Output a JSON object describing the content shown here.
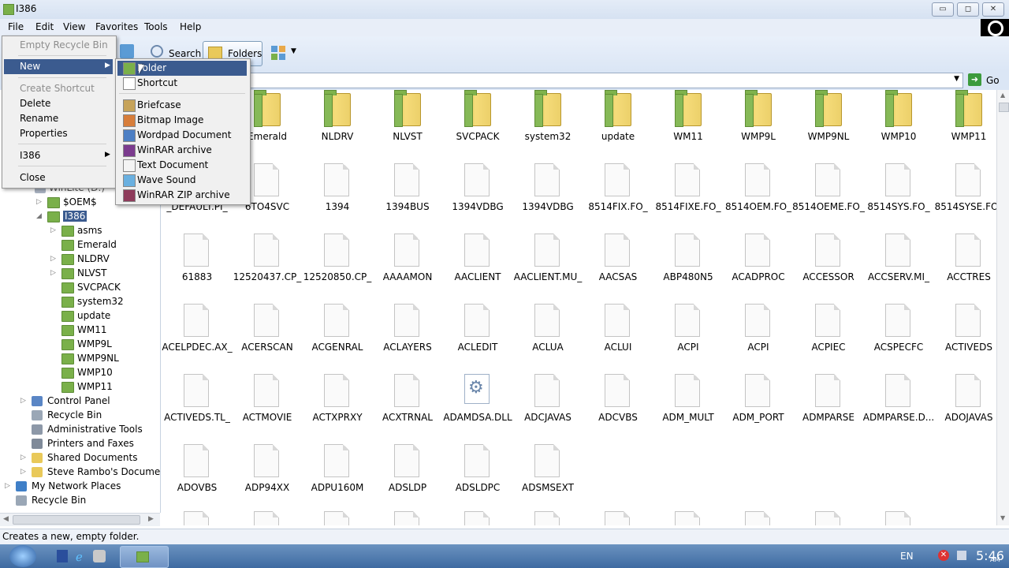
{
  "window": {
    "title": "I386",
    "minimize": "▭",
    "maximize": "◻",
    "close": "✕"
  },
  "menubar": [
    "File",
    "Edit",
    "View",
    "Favorites",
    "Tools",
    "Help"
  ],
  "toolbar": {
    "search_label": "Search",
    "folders_label": "Folders"
  },
  "address": {
    "go_label": "Go"
  },
  "file_menu": {
    "items": [
      {
        "label": "Empty Recycle Bin",
        "disabled": true
      },
      {
        "label": "New",
        "submenu": true,
        "highlighted": true
      },
      {
        "label": "Create Shortcut",
        "disabled": true
      },
      {
        "label": "Delete"
      },
      {
        "label": "Rename"
      },
      {
        "label": "Properties"
      },
      {
        "label": "I386",
        "submenu": true
      },
      {
        "label": "Close"
      }
    ]
  },
  "new_submenu": {
    "items": [
      {
        "label": "Folder",
        "icon": "folder-icon",
        "highlighted": true
      },
      {
        "label": "Shortcut",
        "icon": "shortcut-icon"
      },
      {
        "label": "Briefcase",
        "icon": "briefcase-icon"
      },
      {
        "label": "Bitmap Image",
        "icon": "bitmap-icon"
      },
      {
        "label": "Wordpad Document",
        "icon": "wordpad-icon"
      },
      {
        "label": "WinRAR archive",
        "icon": "winrar-icon"
      },
      {
        "label": "Text Document",
        "icon": "text-document-icon"
      },
      {
        "label": "Wave Sound",
        "icon": "wave-sound-icon"
      },
      {
        "label": "WinRAR ZIP archive",
        "icon": "winrar-zip-icon"
      }
    ]
  },
  "tree": {
    "partial_label": "WinLite (D:)",
    "items": [
      {
        "label": "$OEM$",
        "level": 2,
        "expander": "▷"
      },
      {
        "label": "I386",
        "level": 2,
        "expander": "◢",
        "selected": true
      },
      {
        "label": "asms",
        "level": 3,
        "expander": "▷"
      },
      {
        "label": "Emerald",
        "level": 3,
        "expander": ""
      },
      {
        "label": "NLDRV",
        "level": 3,
        "expander": "▷"
      },
      {
        "label": "NLVST",
        "level": 3,
        "expander": "▷"
      },
      {
        "label": "SVCPACK",
        "level": 3,
        "expander": ""
      },
      {
        "label": "system32",
        "level": 3,
        "expander": ""
      },
      {
        "label": "update",
        "level": 3,
        "expander": ""
      },
      {
        "label": "WM11",
        "level": 3,
        "expander": ""
      },
      {
        "label": "WMP9L",
        "level": 3,
        "expander": ""
      },
      {
        "label": "WMP9NL",
        "level": 3,
        "expander": ""
      },
      {
        "label": "WMP10",
        "level": 3,
        "expander": ""
      },
      {
        "label": "WMP11",
        "level": 3,
        "expander": ""
      },
      {
        "label": "Control Panel",
        "level": 1,
        "expander": "▷",
        "icon": "control-panel-icon"
      },
      {
        "label": "Recycle Bin",
        "level": 1,
        "expander": "",
        "icon": "recycle-bin-icon"
      },
      {
        "label": "Administrative Tools",
        "level": 1,
        "expander": "",
        "icon": "admin-tools-icon"
      },
      {
        "label": "Printers and Faxes",
        "level": 1,
        "expander": "",
        "icon": "printer-icon"
      },
      {
        "label": "Shared Documents",
        "level": 1,
        "expander": "▷",
        "icon": "shared-docs-icon"
      },
      {
        "label": "Steve Rambo's Documents",
        "level": 1,
        "expander": "▷",
        "icon": "user-docs-icon"
      },
      {
        "label": "My Network Places",
        "level": 0,
        "expander": "▷",
        "icon": "network-icon"
      },
      {
        "label": "Recycle Bin",
        "level": 0,
        "expander": "",
        "icon": "recycle-bin-icon"
      }
    ]
  },
  "files": [
    {
      "name": "Emerald",
      "type": "folder"
    },
    {
      "name": "NLDRV",
      "type": "folder"
    },
    {
      "name": "NLVST",
      "type": "folder"
    },
    {
      "name": "SVCPACK",
      "type": "folder"
    },
    {
      "name": "system32",
      "type": "folder"
    },
    {
      "name": "update",
      "type": "folder"
    },
    {
      "name": "WM11",
      "type": "folder"
    },
    {
      "name": "WMP9L",
      "type": "folder"
    },
    {
      "name": "WMP9NL",
      "type": "folder"
    },
    {
      "name": "WMP10",
      "type": "folder"
    },
    {
      "name": "WMP11",
      "type": "folder"
    },
    {
      "name": "_DEFAULT.PI_",
      "type": "file"
    },
    {
      "name": "6TO4SVC",
      "type": "file"
    },
    {
      "name": "1394",
      "type": "file"
    },
    {
      "name": "1394BUS",
      "type": "file"
    },
    {
      "name": "1394VDBG",
      "type": "file"
    },
    {
      "name": "1394VDBG",
      "type": "file"
    },
    {
      "name": "8514FIX.FO_",
      "type": "file"
    },
    {
      "name": "8514FIXE.FO_",
      "type": "file"
    },
    {
      "name": "8514OEM.FO_",
      "type": "file"
    },
    {
      "name": "8514OEME.FO_",
      "type": "file"
    },
    {
      "name": "8514SYS.FO_",
      "type": "file"
    },
    {
      "name": "8514SYSE.FO_",
      "type": "file"
    },
    {
      "name": "61883",
      "type": "file"
    },
    {
      "name": "12520437.CP_",
      "type": "file"
    },
    {
      "name": "12520850.CP_",
      "type": "file"
    },
    {
      "name": "AAAAMON",
      "type": "file"
    },
    {
      "name": "AACLIENT",
      "type": "file"
    },
    {
      "name": "AACLIENT.MU_",
      "type": "file"
    },
    {
      "name": "AACSAS",
      "type": "file"
    },
    {
      "name": "ABP480N5",
      "type": "file"
    },
    {
      "name": "ACADPROC",
      "type": "file"
    },
    {
      "name": "ACCESSOR",
      "type": "file"
    },
    {
      "name": "ACCSERV.MI_",
      "type": "file"
    },
    {
      "name": "ACCTRES",
      "type": "file"
    },
    {
      "name": "ACELPDEC.AX_",
      "type": "file"
    },
    {
      "name": "ACERSCAN",
      "type": "file"
    },
    {
      "name": "ACGENRAL",
      "type": "file"
    },
    {
      "name": "ACLAYERS",
      "type": "file"
    },
    {
      "name": "ACLEDIT",
      "type": "file"
    },
    {
      "name": "ACLUA",
      "type": "file"
    },
    {
      "name": "ACLUI",
      "type": "file"
    },
    {
      "name": "ACPI",
      "type": "file"
    },
    {
      "name": "ACPI",
      "type": "file"
    },
    {
      "name": "ACPIEC",
      "type": "file"
    },
    {
      "name": "ACSPECFC",
      "type": "file"
    },
    {
      "name": "ACTIVEDS",
      "type": "file"
    },
    {
      "name": "ACTIVEDS.TL_",
      "type": "file"
    },
    {
      "name": "ACTMOVIE",
      "type": "file"
    },
    {
      "name": "ACTXPRXY",
      "type": "file"
    },
    {
      "name": "ACXTRNAL",
      "type": "file"
    },
    {
      "name": "ADAMDSA.DLL",
      "type": "dll"
    },
    {
      "name": "ADCJAVAS",
      "type": "file"
    },
    {
      "name": "ADCVBS",
      "type": "file"
    },
    {
      "name": "ADM_MULT",
      "type": "file"
    },
    {
      "name": "ADM_PORT",
      "type": "file"
    },
    {
      "name": "ADMPARSE",
      "type": "file"
    },
    {
      "name": "ADMPARSE.D...",
      "type": "file"
    },
    {
      "name": "ADOJAVAS",
      "type": "file"
    },
    {
      "name": "ADOVBS",
      "type": "file"
    },
    {
      "name": "ADP94XX",
      "type": "file"
    },
    {
      "name": "ADPU160M",
      "type": "file"
    },
    {
      "name": "ADSLDP",
      "type": "file"
    },
    {
      "name": "ADSLDPC",
      "type": "file"
    },
    {
      "name": "ADSMSEXT",
      "type": "file"
    }
  ],
  "statusbar": {
    "text": "Creates a new, empty folder."
  },
  "taskbar": {
    "language": "EN",
    "time": "5:46",
    "ampm": "AM"
  },
  "colors": {
    "folder_green": "#7ab04a",
    "highlight_dark": "#3b5b8f",
    "taskbar": "#4a76ab"
  }
}
